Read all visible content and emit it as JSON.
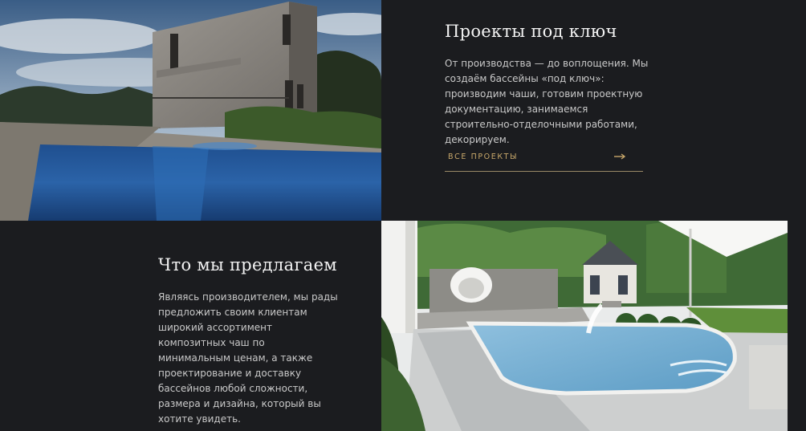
{
  "projects": {
    "title": "Проекты под ключ",
    "text": "От производства — до воплощения. Мы создаём бассейны «под ключ»: производим чаши, готовим проектную документацию, занимаемся строительно-отделочными работами, декорируем.",
    "cta_label": "ВСЕ ПРОЕКТЫ",
    "cta_icon": "arrow-right-icon"
  },
  "offer": {
    "title": "Что мы предлагаем",
    "text": "Являясь производителем, мы рады предложить своим клиентам широкий ассортимент композитных чаш по минимальным ценам, а также проектирование и доставку бассейнов любой сложности, размера и дизайна, который вы хотите увидеть."
  },
  "colors": {
    "background": "#1b1c1f",
    "accent": "#c7a76a",
    "heading": "#f2f2f2",
    "text": "#c9c9c9"
  }
}
